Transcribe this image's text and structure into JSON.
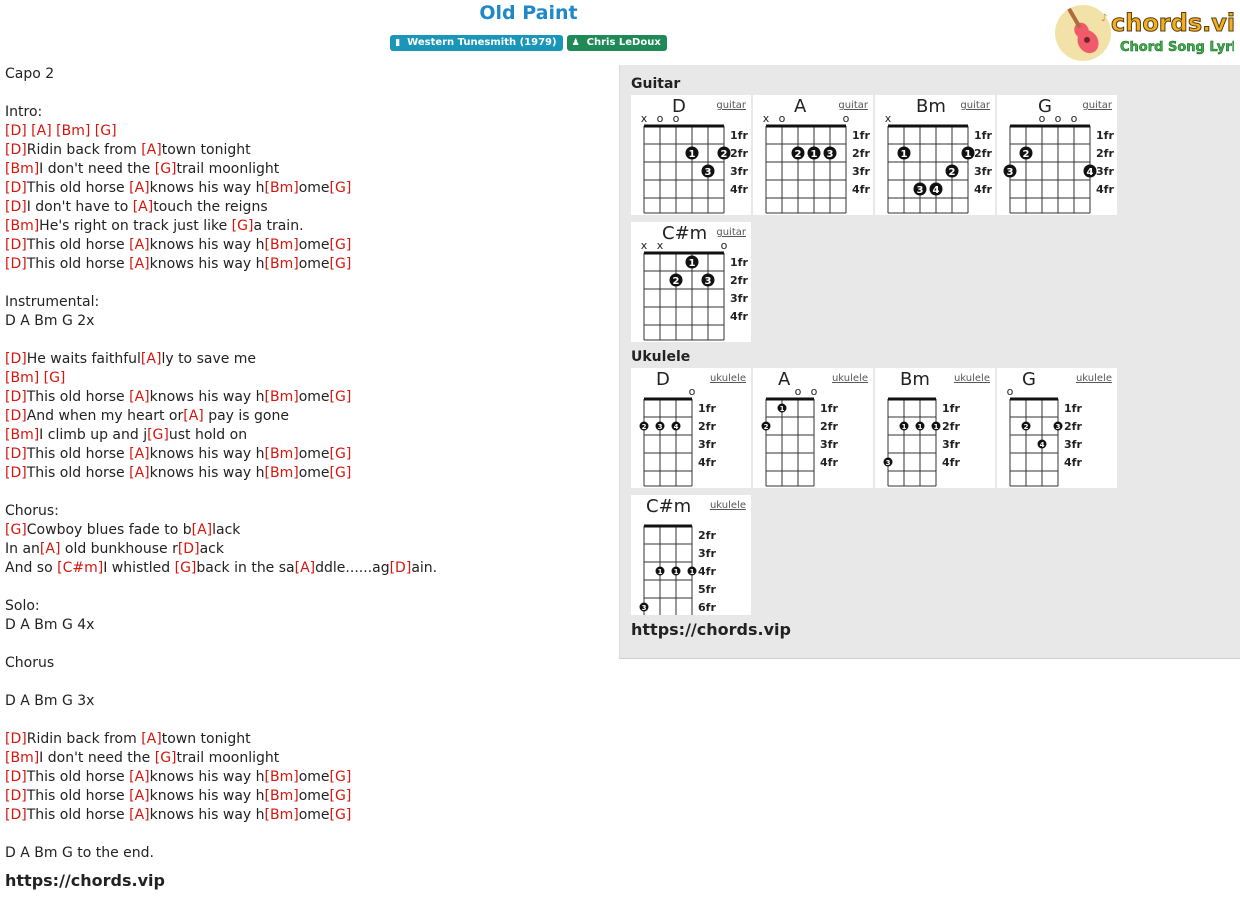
{
  "song": {
    "title": "Old Paint",
    "album": "Western Tunesmith (1979)",
    "artist": "Chris LeDoux",
    "album_icon": "book-icon",
    "artist_icon": "user-icon"
  },
  "logo": {
    "text": "chords.vip",
    "subtitle": "Chord Song Lyric",
    "icon": "ukulele-icon"
  },
  "lyrics": [
    [
      [
        "t",
        "Capo 2"
      ]
    ],
    [],
    [
      [
        "t",
        "Intro:"
      ]
    ],
    [
      [
        "c",
        "[D]"
      ],
      [
        "t",
        " "
      ],
      [
        "c",
        "[A]"
      ],
      [
        "t",
        " "
      ],
      [
        "c",
        "[Bm]"
      ],
      [
        "t",
        " "
      ],
      [
        "c",
        "[G]"
      ]
    ],
    [
      [
        "c",
        "[D]"
      ],
      [
        "t",
        "Ridin back from "
      ],
      [
        "c",
        "[A]"
      ],
      [
        "t",
        "town tonight"
      ]
    ],
    [
      [
        "c",
        "[Bm]"
      ],
      [
        "t",
        "I don't need the "
      ],
      [
        "c",
        "[G]"
      ],
      [
        "t",
        "trail moonlight"
      ]
    ],
    [
      [
        "c",
        "[D]"
      ],
      [
        "t",
        "This old horse "
      ],
      [
        "c",
        "[A]"
      ],
      [
        "t",
        "knows his way h"
      ],
      [
        "c",
        "[Bm]"
      ],
      [
        "t",
        "ome"
      ],
      [
        "c",
        "[G]"
      ]
    ],
    [
      [
        "c",
        "[D]"
      ],
      [
        "t",
        "I don't have to "
      ],
      [
        "c",
        "[A]"
      ],
      [
        "t",
        "touch the reigns"
      ]
    ],
    [
      [
        "c",
        "[Bm]"
      ],
      [
        "t",
        "He's right on track just like "
      ],
      [
        "c",
        "[G]"
      ],
      [
        "t",
        "a train."
      ]
    ],
    [
      [
        "c",
        "[D]"
      ],
      [
        "t",
        "This old horse "
      ],
      [
        "c",
        "[A]"
      ],
      [
        "t",
        "knows his way h"
      ],
      [
        "c",
        "[Bm]"
      ],
      [
        "t",
        "ome"
      ],
      [
        "c",
        "[G]"
      ]
    ],
    [
      [
        "c",
        "[D]"
      ],
      [
        "t",
        "This old horse "
      ],
      [
        "c",
        "[A]"
      ],
      [
        "t",
        "knows his way h"
      ],
      [
        "c",
        "[Bm]"
      ],
      [
        "t",
        "ome"
      ],
      [
        "c",
        "[G]"
      ]
    ],
    [],
    [
      [
        "t",
        "Instrumental:"
      ]
    ],
    [
      [
        "t",
        "D A Bm G 2x"
      ]
    ],
    [],
    [
      [
        "c",
        "[D]"
      ],
      [
        "t",
        "He waits faithful"
      ],
      [
        "c",
        "[A]"
      ],
      [
        "t",
        "ly to save me"
      ]
    ],
    [
      [
        "c",
        "[Bm]"
      ],
      [
        "t",
        " "
      ],
      [
        "c",
        "[G]"
      ]
    ],
    [
      [
        "c",
        "[D]"
      ],
      [
        "t",
        "This old horse "
      ],
      [
        "c",
        "[A]"
      ],
      [
        "t",
        "knows his way h"
      ],
      [
        "c",
        "[Bm]"
      ],
      [
        "t",
        "ome"
      ],
      [
        "c",
        "[G]"
      ]
    ],
    [
      [
        "c",
        "[D]"
      ],
      [
        "t",
        "And when my heart or"
      ],
      [
        "c",
        "[A]"
      ],
      [
        "t",
        " pay is gone"
      ]
    ],
    [
      [
        "c",
        "[Bm]"
      ],
      [
        "t",
        "I climb up and j"
      ],
      [
        "c",
        "[G]"
      ],
      [
        "t",
        "ust hold on"
      ]
    ],
    [
      [
        "c",
        "[D]"
      ],
      [
        "t",
        "This old horse "
      ],
      [
        "c",
        "[A]"
      ],
      [
        "t",
        "knows his way h"
      ],
      [
        "c",
        "[Bm]"
      ],
      [
        "t",
        "ome"
      ],
      [
        "c",
        "[G]"
      ]
    ],
    [
      [
        "c",
        "[D]"
      ],
      [
        "t",
        "This old horse "
      ],
      [
        "c",
        "[A]"
      ],
      [
        "t",
        "knows his way h"
      ],
      [
        "c",
        "[Bm]"
      ],
      [
        "t",
        "ome"
      ],
      [
        "c",
        "[G]"
      ]
    ],
    [],
    [
      [
        "t",
        "Chorus:"
      ]
    ],
    [
      [
        "c",
        "[G]"
      ],
      [
        "t",
        "Cowboy blues fade to b"
      ],
      [
        "c",
        "[A]"
      ],
      [
        "t",
        "lack"
      ]
    ],
    [
      [
        "t",
        "In an"
      ],
      [
        "c",
        "[A]"
      ],
      [
        "t",
        " old bunkhouse r"
      ],
      [
        "c",
        "[D]"
      ],
      [
        "t",
        "ack"
      ]
    ],
    [
      [
        "t",
        "And so "
      ],
      [
        "c",
        "[C#m]"
      ],
      [
        "t",
        "I whistled "
      ],
      [
        "c",
        "[G]"
      ],
      [
        "t",
        "back in the sa"
      ],
      [
        "c",
        "[A]"
      ],
      [
        "t",
        "ddle......ag"
      ],
      [
        "c",
        "[D]"
      ],
      [
        "t",
        "ain."
      ]
    ],
    [],
    [
      [
        "t",
        "Solo:"
      ]
    ],
    [
      [
        "t",
        "D A Bm G 4x"
      ]
    ],
    [],
    [
      [
        "t",
        "Chorus"
      ]
    ],
    [],
    [
      [
        "t",
        "D A Bm G 3x"
      ]
    ],
    [],
    [
      [
        "c",
        "[D]"
      ],
      [
        "t",
        "Ridin back from "
      ],
      [
        "c",
        "[A]"
      ],
      [
        "t",
        "town tonight"
      ]
    ],
    [
      [
        "c",
        "[Bm]"
      ],
      [
        "t",
        "I don't need the "
      ],
      [
        "c",
        "[G]"
      ],
      [
        "t",
        "trail moonlight"
      ]
    ],
    [
      [
        "c",
        "[D]"
      ],
      [
        "t",
        "This old horse "
      ],
      [
        "c",
        "[A]"
      ],
      [
        "t",
        "knows his way h"
      ],
      [
        "c",
        "[Bm]"
      ],
      [
        "t",
        "ome"
      ],
      [
        "c",
        "[G]"
      ]
    ],
    [
      [
        "c",
        "[D]"
      ],
      [
        "t",
        "This old horse "
      ],
      [
        "c",
        "[A]"
      ],
      [
        "t",
        "knows his way h"
      ],
      [
        "c",
        "[Bm]"
      ],
      [
        "t",
        "ome"
      ],
      [
        "c",
        "[G]"
      ]
    ],
    [
      [
        "c",
        "[D]"
      ],
      [
        "t",
        "This old horse "
      ],
      [
        "c",
        "[A]"
      ],
      [
        "t",
        "knows his way h"
      ],
      [
        "c",
        "[Bm]"
      ],
      [
        "t",
        "ome"
      ],
      [
        "c",
        "[G]"
      ]
    ],
    [],
    [
      [
        "t",
        "D A Bm G to the end."
      ]
    ]
  ],
  "footer_url": "https://chords.vip",
  "panel": {
    "guitar_heading": "Guitar",
    "ukulele_heading": "Ukulele",
    "url": "https://chords.vip",
    "guitar": [
      {
        "name": "D",
        "type": "guitar",
        "fret_labels": [
          "1fr",
          "2fr",
          "3fr",
          "4fr"
        ],
        "marks": [
          "x",
          "o",
          "o",
          "",
          "",
          ""
        ],
        "dots": [
          [
            4,
            2,
            "1"
          ],
          [
            6,
            2,
            "2"
          ],
          [
            5,
            3,
            "3"
          ]
        ]
      },
      {
        "name": "A",
        "type": "guitar",
        "fret_labels": [
          "1fr",
          "2fr",
          "3fr",
          "4fr"
        ],
        "marks": [
          "x",
          "o",
          "",
          "",
          "",
          "o"
        ],
        "dots": [
          [
            3,
            2,
            "2"
          ],
          [
            4,
            2,
            "1"
          ],
          [
            5,
            2,
            "3"
          ]
        ]
      },
      {
        "name": "Bm",
        "type": "guitar",
        "fret_labels": [
          "1fr",
          "2fr",
          "3fr",
          "4fr"
        ],
        "marks": [
          "x",
          "",
          "",
          "",
          "",
          ""
        ],
        "dots": [
          [
            2,
            2,
            "1"
          ],
          [
            6,
            2,
            "1"
          ],
          [
            5,
            3,
            "2"
          ],
          [
            3,
            4,
            "3"
          ],
          [
            4,
            4,
            "4"
          ]
        ]
      },
      {
        "name": "G",
        "type": "guitar",
        "fret_labels": [
          "1fr",
          "2fr",
          "3fr",
          "4fr"
        ],
        "marks": [
          "",
          "",
          "o",
          "o",
          "o",
          ""
        ],
        "dots": [
          [
            2,
            2,
            "2"
          ],
          [
            1,
            3,
            "3"
          ],
          [
            6,
            3,
            "4"
          ]
        ]
      },
      {
        "name": "C#m",
        "type": "guitar",
        "fret_labels": [
          "1fr",
          "2fr",
          "3fr",
          "4fr"
        ],
        "marks": [
          "x",
          "x",
          "",
          "",
          "",
          "o"
        ],
        "dots": [
          [
            4,
            1,
            "1"
          ],
          [
            3,
            2,
            "2"
          ],
          [
            5,
            2,
            "3"
          ]
        ]
      }
    ],
    "ukulele": [
      {
        "name": "D",
        "type": "ukulele",
        "fret_labels": [
          "1fr",
          "2fr",
          "3fr",
          "4fr"
        ],
        "marks": [
          "",
          "",
          "",
          "o"
        ],
        "dots": [
          [
            1,
            2,
            "2"
          ],
          [
            2,
            2,
            "3"
          ],
          [
            3,
            2,
            "4"
          ]
        ]
      },
      {
        "name": "A",
        "type": "ukulele",
        "fret_labels": [
          "1fr",
          "2fr",
          "3fr",
          "4fr"
        ],
        "marks": [
          "",
          "",
          "o",
          "o"
        ],
        "dots": [
          [
            1,
            2,
            "2"
          ],
          [
            2,
            1,
            "1"
          ]
        ]
      },
      {
        "name": "Bm",
        "type": "ukulele",
        "fret_labels": [
          "1fr",
          "2fr",
          "3fr",
          "4fr"
        ],
        "marks": [
          "",
          "",
          "",
          ""
        ],
        "dots": [
          [
            2,
            2,
            "1"
          ],
          [
            3,
            2,
            "1"
          ],
          [
            4,
            2,
            "1"
          ],
          [
            1,
            4,
            "3"
          ]
        ]
      },
      {
        "name": "G",
        "type": "ukulele",
        "fret_labels": [
          "1fr",
          "2fr",
          "3fr",
          "4fr"
        ],
        "marks": [
          "o",
          "",
          "",
          ""
        ],
        "dots": [
          [
            2,
            2,
            "2"
          ],
          [
            4,
            2,
            "3"
          ],
          [
            3,
            3,
            "4"
          ]
        ]
      },
      {
        "name": "C#m",
        "type": "ukulele",
        "fret_labels": [
          "2fr",
          "3fr",
          "4fr",
          "5fr",
          "6fr"
        ],
        "marks": [
          "",
          "",
          "",
          ""
        ],
        "dots": [
          [
            2,
            3,
            "1"
          ],
          [
            3,
            3,
            "1"
          ],
          [
            4,
            3,
            "1"
          ],
          [
            1,
            5,
            "3"
          ]
        ]
      }
    ]
  }
}
